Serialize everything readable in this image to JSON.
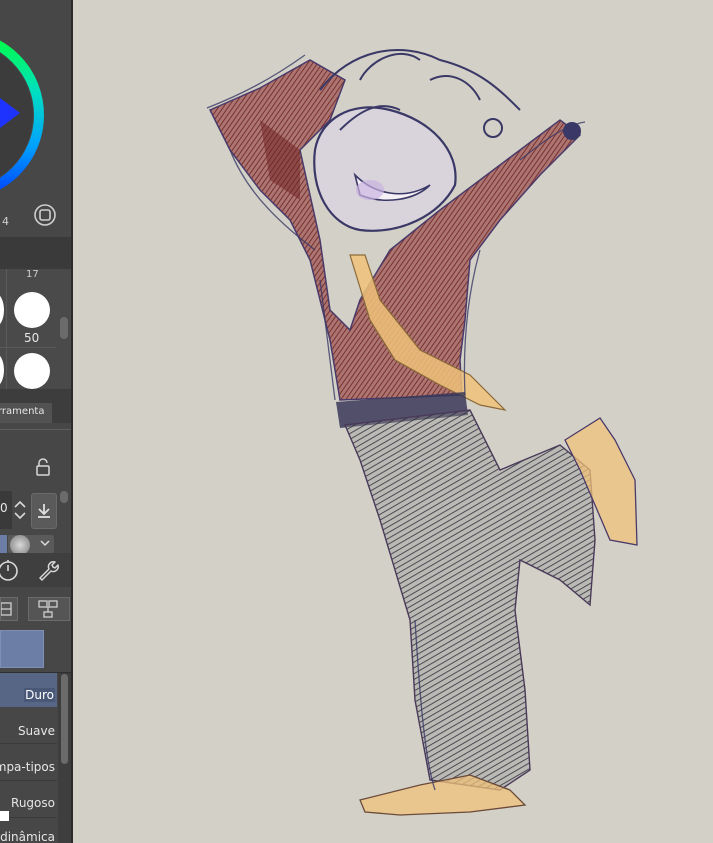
{
  "colors": {
    "panel_bg": "#474747",
    "canvas_bg": "#d3d1c7",
    "accent": "#6c7ea5",
    "selected_row": "#566684"
  },
  "color_wheel": {
    "value_text": "4",
    "marker_color": "#1a2fff"
  },
  "brush_size": {
    "top_label": "17",
    "label": "50"
  },
  "tool_tab": {
    "label": "rramenta"
  },
  "tool_property": {
    "value": "0",
    "icons": [
      "lock-icon",
      "stepper-icon",
      "download-icon"
    ]
  },
  "subtools": {
    "icons": [
      "timer-icon",
      "wrench-icon",
      "layout-icon",
      "network-icon"
    ]
  },
  "brush_list": {
    "items": [
      {
        "label": "Duro",
        "selected": true
      },
      {
        "label": "Suave",
        "selected": false
      },
      {
        "label": "mpa-tipos",
        "selected": false
      },
      {
        "label": "Rugoso",
        "selected": false
      },
      {
        "label": "dinâmica",
        "selected": false
      }
    ]
  }
}
